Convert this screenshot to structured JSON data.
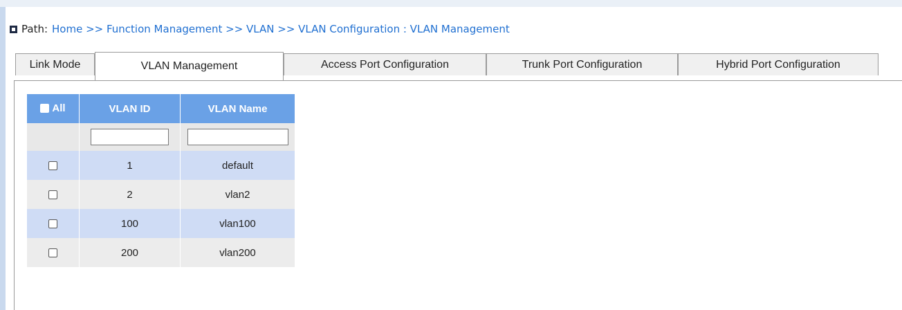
{
  "path": {
    "prefix": "Path:",
    "trail": "Home >> Function Management >> VLAN >> VLAN Configuration : VLAN Management"
  },
  "tabs": [
    {
      "label": "Link Mode",
      "active": false
    },
    {
      "label": "VLAN Management",
      "active": true
    },
    {
      "label": "Access Port Configuration",
      "active": false
    },
    {
      "label": "Trunk Port Configuration",
      "active": false
    },
    {
      "label": "Hybrid Port Configuration",
      "active": false
    }
  ],
  "table": {
    "headers": {
      "select_all": "All",
      "vlan_id": "VLAN ID",
      "vlan_name": "VLAN Name"
    },
    "filter": {
      "vlan_id_value": "",
      "vlan_name_value": ""
    },
    "rows": [
      {
        "vlan_id": "1",
        "vlan_name": "default",
        "checked": false
      },
      {
        "vlan_id": "2",
        "vlan_name": "vlan2",
        "checked": false
      },
      {
        "vlan_id": "100",
        "vlan_name": "vlan100",
        "checked": false
      },
      {
        "vlan_id": "200",
        "vlan_name": "vlan200",
        "checked": false
      }
    ]
  },
  "colors": {
    "header_bg": "#6aa1e6",
    "row_odd_bg": "#cfdcf5",
    "row_even_bg": "#ececec",
    "link": "#1f6fd1"
  }
}
